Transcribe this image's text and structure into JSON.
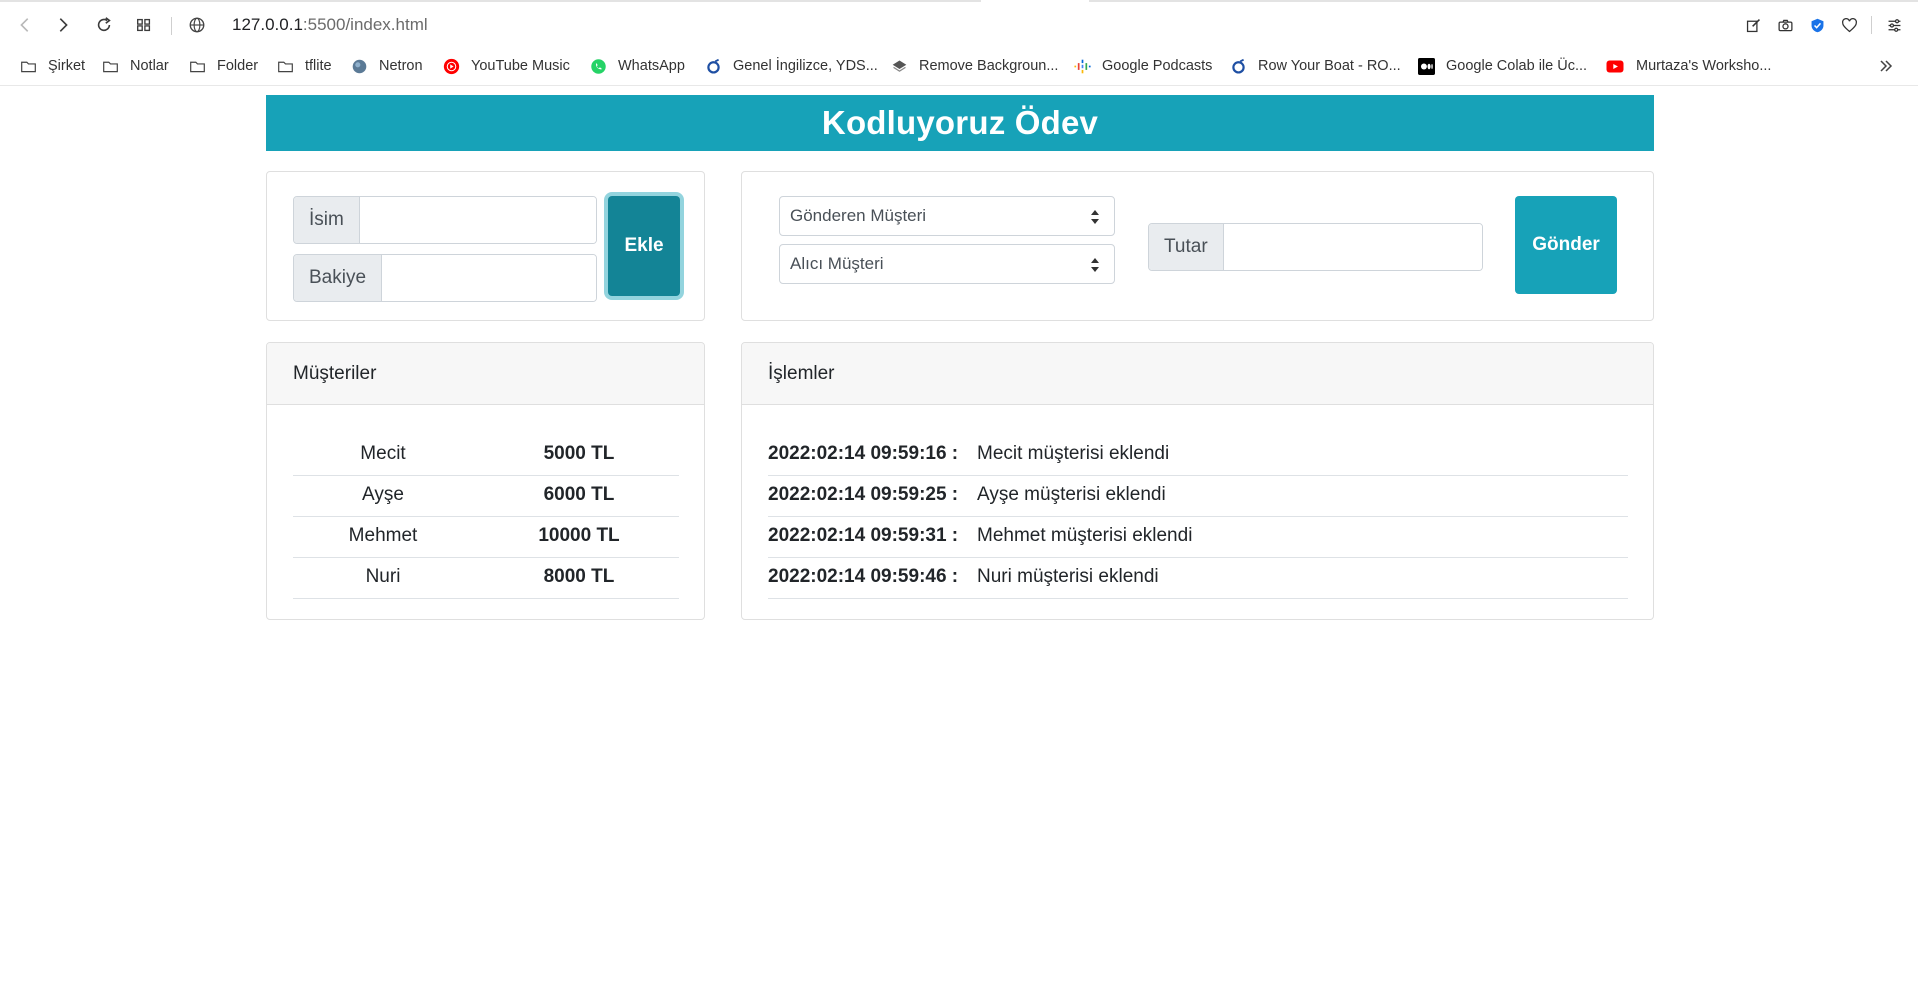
{
  "browser": {
    "url_host": "127.0.0.1",
    "url_path": ":5500/index.html",
    "bookmarks": [
      {
        "label": "Şirket",
        "icon": "folder-icon"
      },
      {
        "label": "Notlar",
        "icon": "folder-icon"
      },
      {
        "label": "Folder",
        "icon": "folder-icon"
      },
      {
        "label": "tflite",
        "icon": "folder-icon"
      },
      {
        "label": "Netron",
        "icon": "netron-icon"
      },
      {
        "label": "YouTube Music",
        "icon": "youtube-music-icon"
      },
      {
        "label": "WhatsApp",
        "icon": "whatsapp-icon"
      },
      {
        "label": "Genel İngilizce, YDS...",
        "icon": "site-icon"
      },
      {
        "label": "Remove Backgroun...",
        "icon": "layers-icon"
      },
      {
        "label": "Google Podcasts",
        "icon": "google-podcasts-icon"
      },
      {
        "label": "Row Your Boat - RO...",
        "icon": "site-icon"
      },
      {
        "label": "Google Colab ile Üc...",
        "icon": "medium-icon"
      },
      {
        "label": "Murtaza's Worksho...",
        "icon": "youtube-icon"
      }
    ]
  },
  "app": {
    "title": "Kodluyoruz Ödev"
  },
  "add_form": {
    "name_label": "İsim",
    "name_value": "",
    "balance_label": "Bakiye",
    "balance_value": "",
    "add_button": "Ekle"
  },
  "transfer_form": {
    "sender_select": "Gönderen Müşteri",
    "receiver_select": "Alıcı Müşteri",
    "amount_label": "Tutar",
    "amount_value": "",
    "send_button": "Gönder"
  },
  "customers": {
    "title": "Müşteriler",
    "rows": [
      {
        "name": "Mecit",
        "balance": "5000 TL"
      },
      {
        "name": "Ayşe",
        "balance": "6000 TL"
      },
      {
        "name": "Mehmet",
        "balance": "10000 TL"
      },
      {
        "name": "Nuri",
        "balance": "8000 TL"
      }
    ]
  },
  "transactions": {
    "title": "İşlemler",
    "rows": [
      {
        "time": "2022:02:14 09:59:16 :",
        "message": "Mecit müşterisi eklendi"
      },
      {
        "time": "2022:02:14 09:59:25 :",
        "message": "Ayşe müşterisi eklendi"
      },
      {
        "time": "2022:02:14 09:59:31 :",
        "message": "Mehmet müşterisi eklendi"
      },
      {
        "time": "2022:02:14 09:59:46 :",
        "message": "Nuri müşterisi eklendi"
      }
    ]
  },
  "colors": {
    "accent": "#17a2b8",
    "accent_dark": "#138496"
  }
}
